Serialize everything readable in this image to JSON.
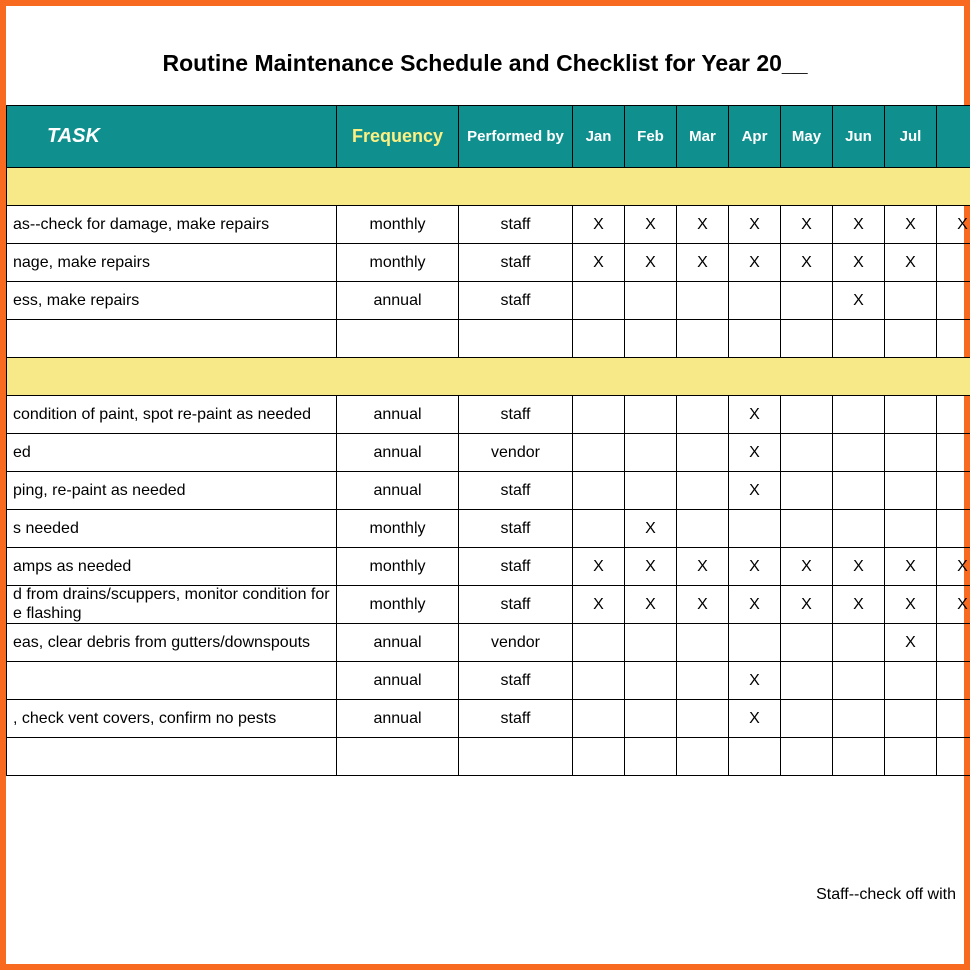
{
  "title": "Routine Maintenance Schedule and Checklist for Year 20__",
  "headers": {
    "task": "TASK",
    "frequency": "Frequency",
    "performed_by": "Performed by",
    "months": [
      "Jan",
      "Feb",
      "Mar",
      "Apr",
      "May",
      "Jun",
      "Jul",
      ""
    ]
  },
  "mark": "X",
  "sections": [
    {
      "rows": [
        {
          "task": "as--check for damage, make repairs",
          "frequency": "monthly",
          "performed_by": "staff",
          "months": [
            true,
            true,
            true,
            true,
            true,
            true,
            true,
            true
          ]
        },
        {
          "task": "nage, make repairs",
          "frequency": "monthly",
          "performed_by": "staff",
          "months": [
            true,
            true,
            true,
            true,
            true,
            true,
            true,
            false
          ]
        },
        {
          "task": "ess, make repairs",
          "frequency": "annual",
          "performed_by": "staff",
          "months": [
            false,
            false,
            false,
            false,
            false,
            true,
            false,
            false
          ]
        },
        {
          "task": "",
          "frequency": "",
          "performed_by": "",
          "months": [
            false,
            false,
            false,
            false,
            false,
            false,
            false,
            false
          ]
        }
      ]
    },
    {
      "rows": [
        {
          "task": "condition of paint, spot re-paint as needed",
          "frequency": "annual",
          "performed_by": "staff",
          "months": [
            false,
            false,
            false,
            true,
            false,
            false,
            false,
            false
          ]
        },
        {
          "task": "ed",
          "frequency": "annual",
          "performed_by": "vendor",
          "months": [
            false,
            false,
            false,
            true,
            false,
            false,
            false,
            false
          ]
        },
        {
          "task": "ping, re-paint as needed",
          "frequency": "annual",
          "performed_by": "staff",
          "months": [
            false,
            false,
            false,
            true,
            false,
            false,
            false,
            false
          ]
        },
        {
          "task": "s needed",
          "frequency": "monthly",
          "performed_by": "staff",
          "months": [
            false,
            true,
            false,
            false,
            false,
            false,
            false,
            false
          ]
        },
        {
          "task": "amps as needed",
          "frequency": "monthly",
          "performed_by": "staff",
          "months": [
            true,
            true,
            true,
            true,
            true,
            true,
            true,
            true
          ]
        },
        {
          "task": "d from drains/scuppers, monitor condition for e flashing",
          "wrap": true,
          "frequency": "monthly",
          "performed_by": "staff",
          "months": [
            true,
            true,
            true,
            true,
            true,
            true,
            true,
            true
          ]
        },
        {
          "task": "eas, clear debris from gutters/downspouts",
          "frequency": "annual",
          "performed_by": "vendor",
          "months": [
            false,
            false,
            false,
            false,
            false,
            false,
            true,
            false
          ]
        },
        {
          "task": "",
          "frequency": "annual",
          "performed_by": "staff",
          "months": [
            false,
            false,
            false,
            true,
            false,
            false,
            false,
            false
          ]
        },
        {
          "task": ", check vent covers, confirm no pests",
          "frequency": "annual",
          "performed_by": "staff",
          "months": [
            false,
            false,
            false,
            true,
            false,
            false,
            false,
            false
          ]
        },
        {
          "task": "",
          "frequency": "",
          "performed_by": "",
          "months": [
            false,
            false,
            false,
            false,
            false,
            false,
            false,
            false
          ]
        }
      ]
    }
  ],
  "footnote": "Staff--check off with"
}
